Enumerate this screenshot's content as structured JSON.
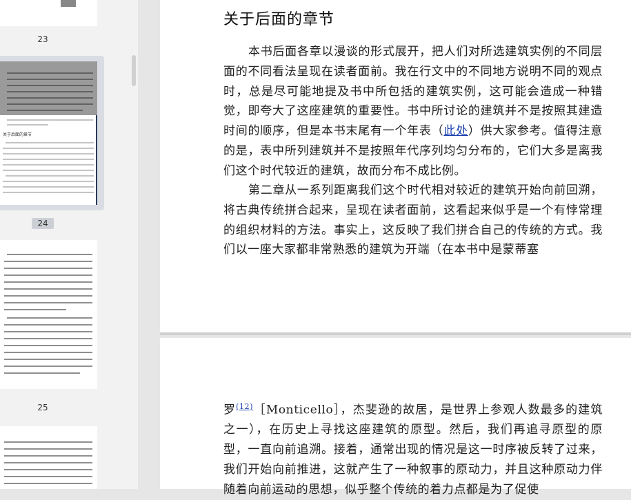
{
  "sidebar": {
    "pages": [
      {
        "number": "23"
      },
      {
        "number": "24",
        "thumb_title": "关于后面的章节"
      },
      {
        "number": "25"
      }
    ]
  },
  "page1": {
    "heading": "关于后面的章节",
    "para1": "本书后面各章以漫谈的形式展开，把人们对所选建筑实例的不同层面的不同看法呈现在读者面前。我在行文中的不同地方说明不同的观点时，总是尽可能地提及书中所包括的建筑实例，这可能会造成一种错觉，即夸大了这座建筑的重要性。书中所讨论的建筑并不是按照其建造时间的顺序，但是本书末尾有一个年表（",
    "para1_link": "此处",
    "para1_end": "）供大家参考。值得注意的是，表中所列建筑并不是按照年代序列均匀分布的，它们大多是离我们这个时代较近的建筑，故而分布不成比例。",
    "para2": "第二章从一系列距离我们这个时代相对较近的建筑开始向前回溯，将古典传统拼合起来，呈现在读者面前，这看起来似乎是一个有悖常理的组织材料的方法。事实上，这反映了我们拼合自己的传统的方式。我们以一座大家都非常熟悉的建筑为开端（在本书中是蒙蒂塞"
  },
  "page2": {
    "start": "罗",
    "footnote": "(12)",
    "text": "［Monticello］，杰斐逊的故居，是世界上参观人数最多的建筑之一），在历史上寻找这座建筑的原型。然后，我们再追寻原型的原型，一直向前追溯。接着，通常出现的情况是这一时序被反转了过来，我们开始向前推进，这就产生了一种叙事的原动力，并且这种原动力伴随着向前运动的思想，似乎整个传统的着力点都是为了促使"
  }
}
